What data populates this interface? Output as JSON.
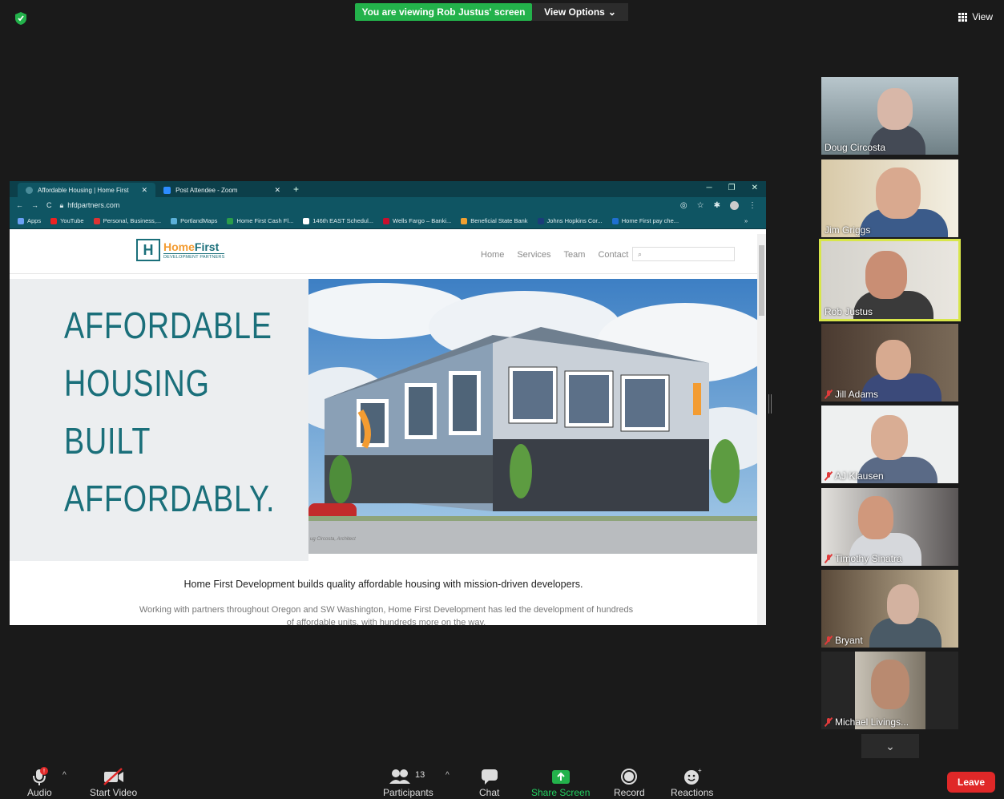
{
  "top": {
    "viewing_banner": "You are viewing Rob Justus' screen",
    "view_options": "View Options",
    "view_label": "View"
  },
  "browser": {
    "tabs": [
      {
        "title": "Affordable Housing | Home First"
      },
      {
        "title": "Post Attendee - Zoom"
      }
    ],
    "url": "hfdpartners.com",
    "bookmarks": [
      "Apps",
      "YouTube",
      "Personal, Business,...",
      "PortlandMaps",
      "Home First Cash Fl...",
      "146th EAST Schedul...",
      "Wells Fargo – Banki...",
      "Beneficial State Bank",
      "Johns Hopkins Cor...",
      "Home First pay che..."
    ],
    "bookmark_more": "»"
  },
  "website": {
    "logo_home": "Home",
    "logo_first": "First",
    "logo_sub": "DEVELOPMENT PARTNERS",
    "nav": [
      "Home",
      "Services",
      "Team",
      "Contact"
    ],
    "headline": [
      "AFFORDABLE",
      "HOUSING",
      "BUILT",
      "AFFORDABLY."
    ],
    "image_caption": "ug Circosta, Architect",
    "tagline": "Home First Development builds quality affordable housing with mission-driven developers.",
    "subline": "Working with partners throughout Oregon and SW Washington, Home First Development has led the development of hundreds of affordable units, with hundreds more on the way."
  },
  "participants_gallery": [
    {
      "name": "Doug Circosta",
      "muted": false
    },
    {
      "name": "Jim Griggs",
      "muted": false
    },
    {
      "name": "Rob Justus",
      "muted": false,
      "active": true
    },
    {
      "name": "Jill Adams",
      "muted": true
    },
    {
      "name": "AJ Klausen",
      "muted": true
    },
    {
      "name": "Timothy Sinatra",
      "muted": true
    },
    {
      "name": "Bryant",
      "muted": true
    },
    {
      "name": "Michael Livings...",
      "muted": true
    }
  ],
  "toolbar": {
    "audio": "Audio",
    "start_video": "Start Video",
    "participants": "Participants",
    "participants_count": "13",
    "chat": "Chat",
    "share_screen": "Share Screen",
    "record": "Record",
    "reactions": "Reactions",
    "leave": "Leave"
  },
  "colors": {
    "banner_green": "#23b24b",
    "active_speaker": "#d8e64a",
    "leave_red": "#e02828",
    "teal_brand": "#1a6f7a",
    "orange_brand": "#f39c32"
  }
}
